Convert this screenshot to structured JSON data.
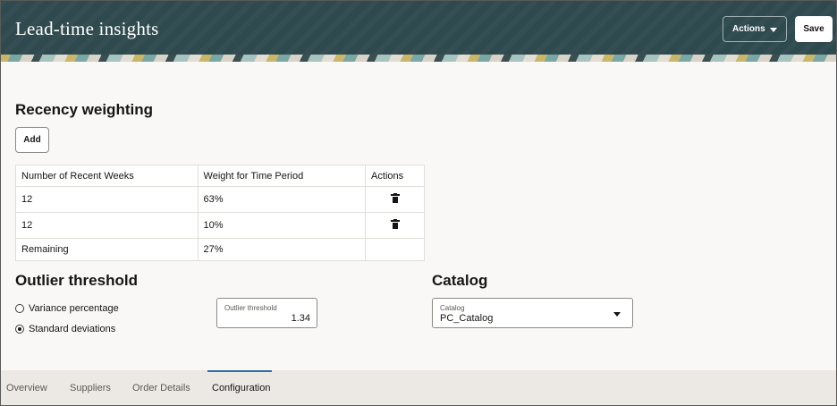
{
  "header": {
    "title": "Lead-time insights",
    "actions_label": "Actions",
    "save_label": "Save"
  },
  "recency": {
    "title": "Recency weighting",
    "add_label": "Add",
    "columns": [
      "Number of Recent Weeks",
      "Weight for Time Period",
      "Actions"
    ],
    "rows": [
      {
        "weeks": "12",
        "weight": "63%",
        "deletable": true
      },
      {
        "weeks": "12",
        "weight": "10%",
        "deletable": true
      },
      {
        "weeks": "Remaining",
        "weight": "27%",
        "deletable": false
      }
    ]
  },
  "outlier": {
    "title": "Outlier threshold",
    "options": [
      {
        "label": "Variance percentage",
        "selected": false
      },
      {
        "label": "Standard deviations",
        "selected": true
      }
    ],
    "threshold_label": "Outlier threshold",
    "threshold_value": "1.34"
  },
  "catalog": {
    "title": "Catalog",
    "field_label": "Catalog",
    "selected_value": "PC_Catalog"
  },
  "tabs": [
    {
      "label": "Overview",
      "active": false
    },
    {
      "label": "Suppliers",
      "active": false
    },
    {
      "label": "Order Details",
      "active": false
    },
    {
      "label": "Configuration",
      "active": true
    }
  ],
  "colors": {
    "header_bg": "#2f4a4f",
    "tab_indicator": "#2f6fa8",
    "page_bg": "#f9f8f6"
  },
  "icons": {
    "delete": "trash-icon",
    "dropdown": "chevron-down-icon"
  }
}
